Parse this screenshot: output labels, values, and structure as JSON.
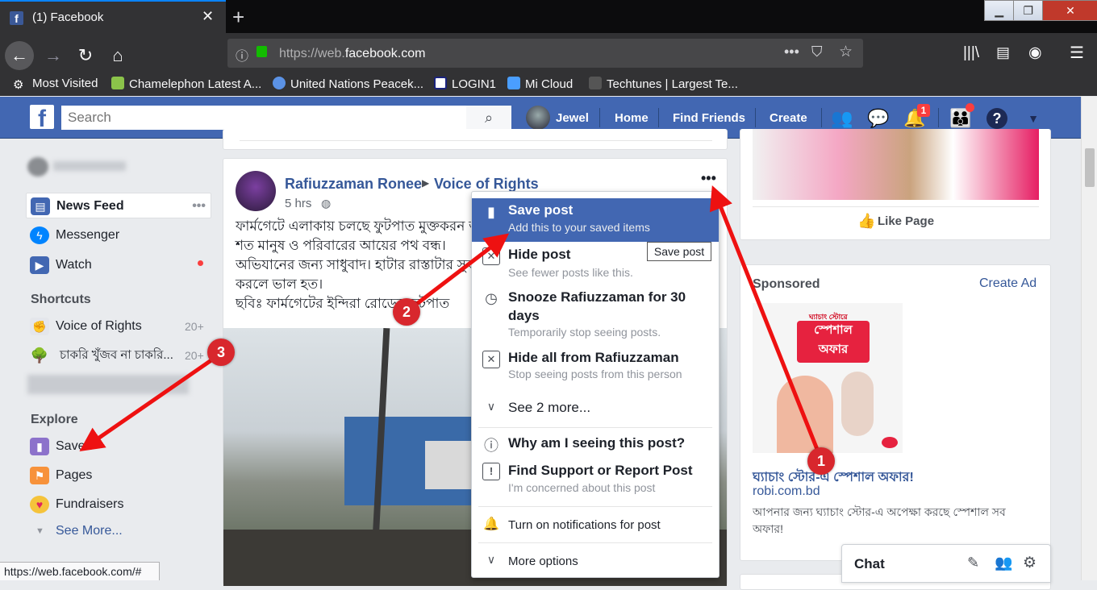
{
  "browser": {
    "tab_title": "(1) Facebook",
    "url_prefix": "https://web.",
    "url_domain": "facebook.com",
    "bookmarks": [
      "Most Visited",
      "Chamelephon Latest A...",
      "United Nations Peacek...",
      "LOGIN1",
      "Mi Cloud",
      "Techtunes | Largest Te..."
    ],
    "status_url": "https://web.facebook.com/#"
  },
  "fb": {
    "search_placeholder": "Search",
    "user_name": "Jewel",
    "nav": [
      "Home",
      "Find Friends",
      "Create"
    ],
    "notif_count": "1"
  },
  "sidebar": {
    "items": [
      "News Feed",
      "Messenger",
      "Watch"
    ],
    "shortcuts_title": "Shortcuts",
    "shortcuts": [
      {
        "label": "Voice of Rights",
        "count": "20+"
      },
      {
        "label": "চাকরি খুঁজব না চাকরি...",
        "count": "20+"
      }
    ],
    "explore_title": "Explore",
    "explore": [
      "Saved",
      "Pages",
      "Fundraisers"
    ],
    "see_more": "See More..."
  },
  "post": {
    "author": "Rafiuzzaman Ronee",
    "group": "Voice of Rights",
    "time": "5 hrs",
    "lines": [
      "ফার্মগেটে এলাকায় চলছে ফুটপাত মুক্তকরন অভি",
      "শত মানুষ ও পরিবারের আয়ের পথ বন্ধ।",
      "অভিযানের জন্য সাধুবাদ। হাটার রাস্তাটার সুব",
      "করলে ভাল হত।",
      "ছবিঃ ফার্মগেটের ইন্দিরা রোডের ফুটপাত"
    ]
  },
  "menu": {
    "save_title": "Save post",
    "save_sub": "Add this to your saved items",
    "tooltip": "Save post",
    "hide_title": "Hide post",
    "hide_sub": "See fewer posts like this.",
    "snooze_title_1": "Snooze Rafiuzzaman for 30",
    "snooze_title_2": "days",
    "snooze_sub": "Temporarily stop seeing posts.",
    "hideall_title": "Hide all from Rafiuzzaman",
    "hideall_sub": "Stop seeing posts from this person",
    "see_more": "See 2 more...",
    "why": "Why am I seeing this post?",
    "report_title": "Find Support or Report Post",
    "report_sub": "I'm concerned about this post",
    "notif": "Turn on notifications for post",
    "more": "More options"
  },
  "right": {
    "like_page": "Like Page",
    "sponsored": "Sponsored",
    "create_ad": "Create Ad",
    "ad_image_text_1": "ঘ্যাচাং স্টোরে",
    "ad_image_text_2": "স্পেশাল",
    "ad_image_text_3": "অফার",
    "ad_title": "ঘ্যাচাং স্টোর-এ স্পেশাল অফার!",
    "ad_domain": "robi.com.bd",
    "ad_body_1": "আপনার জন্য ঘ্যাচাং স্টোর-এ অপেক্ষা করছে স্পেশাল সব",
    "ad_body_2": "অফার!",
    "chat": "Chat"
  },
  "annotations": [
    "1",
    "2",
    "3"
  ]
}
